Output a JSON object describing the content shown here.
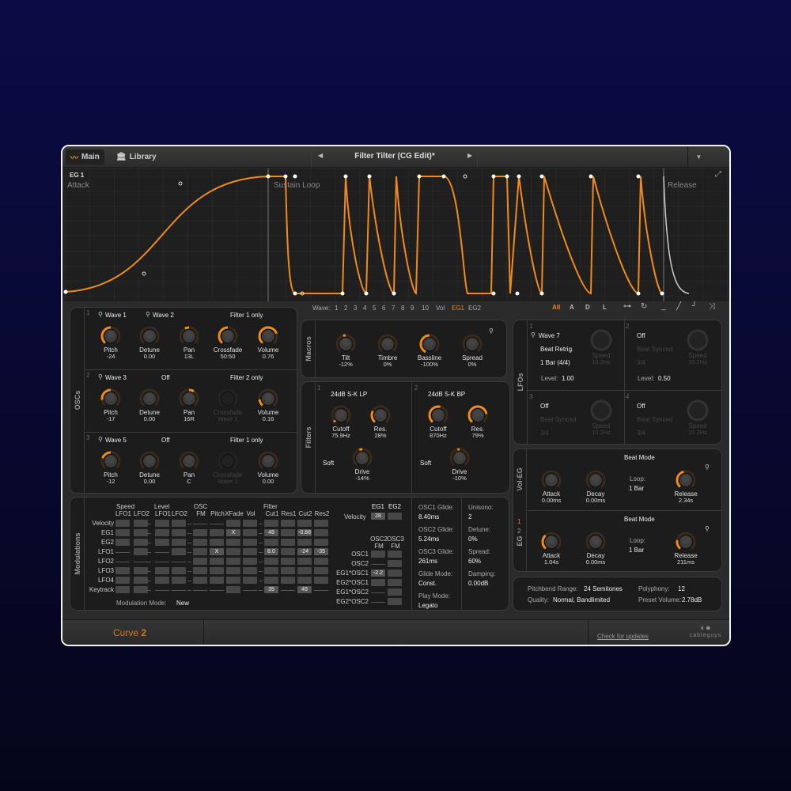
{
  "colors": {
    "accent": "#f08a1c",
    "bg": "#2b2b2b"
  },
  "topbar": {
    "main_tab": "Main",
    "library_tab": "Library",
    "preset_title": "Filter Tilter (CG Edit)*",
    "prev_icon": "triangle-left",
    "next_icon": "triangle-right",
    "menu_icon": "triangle-down"
  },
  "eg": {
    "title": "EG 1",
    "attack": "Attack",
    "sustain": "Sustain Loop",
    "release": "Release"
  },
  "wave_row": {
    "label": "Wave:",
    "items": [
      "1",
      "2",
      "3",
      "4",
      "5",
      "6",
      "7",
      "8",
      "9",
      "10",
      "Vol",
      "EG1",
      "EG2"
    ],
    "active": "EG1",
    "filters": [
      "All",
      "A",
      "D",
      "L"
    ],
    "active_filter": "All"
  },
  "oscs": {
    "label": "OSCs",
    "rows": [
      {
        "num": "1",
        "wave_a": "Wave 1",
        "wave_b": "Wave 2",
        "filter": "Filter 1 only",
        "knobs": [
          {
            "label": "Pitch",
            "value": "-24",
            "amount": -0.5
          },
          {
            "label": "Detune",
            "value": "0.00",
            "amount": 0
          },
          {
            "label": "Pan",
            "value": "13L",
            "amount": -0.1
          },
          {
            "label": "Crossfade",
            "value": "50:50",
            "amount": 0.5,
            "uni": true
          },
          {
            "label": "Volume",
            "value": "0.76",
            "amount": 0.76,
            "uni": true
          }
        ]
      },
      {
        "num": "2",
        "wave_a": "Wave 3",
        "wave_b": "Off",
        "filter": "Filter 2 only",
        "knobs": [
          {
            "label": "Pitch",
            "value": "-17",
            "amount": -0.35
          },
          {
            "label": "Detune",
            "value": "0.00",
            "amount": 0
          },
          {
            "label": "Pan",
            "value": "16R",
            "amount": 0.12
          },
          {
            "label": "Crossfade",
            "value": "Wave 1",
            "amount": 0,
            "off": true
          },
          {
            "label": "Volume",
            "value": "0.16",
            "amount": 0.16,
            "uni": true
          }
        ]
      },
      {
        "num": "3",
        "wave_a": "Wave 5",
        "wave_b": "Off",
        "filter": "Filter 1 only",
        "knobs": [
          {
            "label": "Pitch",
            "value": "-12",
            "amount": -0.25
          },
          {
            "label": "Detune",
            "value": "0.00",
            "amount": 0
          },
          {
            "label": "Pan",
            "value": "C",
            "amount": 0
          },
          {
            "label": "Crossfade",
            "value": "Wave 1",
            "amount": 0,
            "off": true
          },
          {
            "label": "Volume",
            "value": "0.00",
            "amount": 0,
            "uni": true
          }
        ]
      }
    ]
  },
  "macros": {
    "label": "Macros",
    "knobs": [
      {
        "label": "Tilt",
        "value": "-12%",
        "amount": -0.06
      },
      {
        "label": "Timbre",
        "value": "0%",
        "amount": 0
      },
      {
        "label": "Bassline",
        "value": "-100%",
        "amount": -0.55
      },
      {
        "label": "Spread",
        "value": "0%",
        "amount": 0
      }
    ]
  },
  "filters": {
    "label": "Filters",
    "units": [
      {
        "num": "1",
        "type": "24dB S-K LP",
        "drive_mode": "Soft",
        "knobs": [
          {
            "label": "Cutoff",
            "value": "75.9Hz",
            "amount": 0.05,
            "uni": true
          },
          {
            "label": "Res.",
            "value": "28%",
            "amount": 0.28,
            "uni": true
          },
          {
            "label": "Drive",
            "value": "-14%",
            "amount": -0.07
          }
        ]
      },
      {
        "num": "2",
        "type": "24dB S-K BP",
        "drive_mode": "Soft",
        "knobs": [
          {
            "label": "Cutoff",
            "value": "870Hz",
            "amount": 0.55,
            "uni": true
          },
          {
            "label": "Res.",
            "value": "79%",
            "amount": 0.79,
            "uni": true
          },
          {
            "label": "Drive",
            "value": "-10%",
            "amount": -0.05
          }
        ]
      }
    ]
  },
  "lfos": {
    "label": "LFOs",
    "units": [
      {
        "num": "1",
        "wave": "Wave 7",
        "mode": "Beat Retrig.",
        "rate": "1 Bar (4/4)",
        "level_label": "Level:",
        "level": "1.00",
        "speed_label": "Speed",
        "speed": "10.2Hz",
        "active": true
      },
      {
        "num": "2",
        "wave": "Off",
        "mode": "Beat Synced",
        "rate": "3/4",
        "level_label": "Level:",
        "level": "0.50",
        "speed_label": "Speed",
        "speed": "10.2Hz",
        "active": false
      },
      {
        "num": "3",
        "wave": "Off",
        "mode": "Beat Synced",
        "rate": "3/4",
        "speed_label": "Speed",
        "speed": "10.2Hz",
        "active": false
      },
      {
        "num": "4",
        "wave": "Off",
        "mode": "Beat Synced",
        "rate": "3/4",
        "speed_label": "Speed",
        "speed": "10.2Hz",
        "active": false
      }
    ]
  },
  "vol_eg": {
    "label": "Vol-EG",
    "mode": "Beat Mode",
    "loop_label": "Loop:",
    "loop": "1 Bar",
    "knobs": [
      {
        "label": "Attack",
        "value": "0.00ms",
        "amount": 0,
        "uni": true
      },
      {
        "label": "Decay",
        "value": "0.00ms",
        "amount": 0,
        "uni": true
      },
      {
        "label": "Release",
        "value": "2.34s",
        "amount": 0.45,
        "uni": true
      }
    ]
  },
  "eg_panel": {
    "label": "EG",
    "sel1": "1",
    "sel2": "2",
    "mode": "Beat Mode",
    "loop_label": "Loop:",
    "loop": "1 Bar",
    "knobs": [
      {
        "label": "Attack",
        "value": "1.04s",
        "amount": 0.35,
        "uni": true
      },
      {
        "label": "Decay",
        "value": "0.00ms",
        "amount": 0,
        "uni": true
      },
      {
        "label": "Release",
        "value": "211ms",
        "amount": 0.22,
        "uni": true
      }
    ]
  },
  "global": {
    "pitchbend_label": "Pitchbend Range:",
    "pitchbend": "24 Semitones",
    "polyphony_label": "Polyphony:",
    "polyphony": "12",
    "quality_label": "Quality:",
    "quality": "Normal, Bandlimited",
    "preset_volume_label": "Preset Volume:",
    "preset_volume": "2.78dB"
  },
  "modulations": {
    "label": "Modulations",
    "groups": [
      "Speed",
      "Level",
      "OSC",
      "Filter"
    ],
    "columns": [
      "LFO1",
      "LFO2",
      "LFO1",
      "LFO2",
      "FM",
      "Pitch",
      "XFade",
      "Vol",
      "Cut1",
      "Res1",
      "Cut2",
      "Res2"
    ],
    "rows": [
      {
        "name": "Velocity",
        "cells": [
          "",
          "",
          null,
          "",
          "",
          null,
          null,
          null,
          "",
          "",
          null,
          "",
          "",
          "",
          ""
        ]
      },
      {
        "name": "EG1",
        "cells": [
          "",
          "",
          null,
          "",
          "",
          null,
          "",
          "",
          "X",
          "",
          null,
          "48",
          "",
          "-0.88",
          ""
        ]
      },
      {
        "name": "EG2",
        "cells": [
          "",
          "",
          null,
          "",
          "",
          null,
          "",
          "",
          "",
          "",
          null,
          "",
          "",
          "",
          ""
        ]
      },
      {
        "name": "LFO1",
        "cells": [
          null,
          "",
          null,
          null,
          "",
          null,
          "",
          "X",
          "",
          "",
          null,
          "8.0",
          "",
          "-24",
          "-35"
        ]
      },
      {
        "name": "LFO2",
        "cells": [
          null,
          null,
          null,
          null,
          null,
          null,
          "",
          "",
          "",
          "",
          null,
          "",
          "",
          "",
          ""
        ]
      },
      {
        "name": "LFO3",
        "cells": [
          "",
          "",
          null,
          "",
          "",
          null,
          "",
          "",
          "",
          "",
          null,
          "",
          "",
          "",
          ""
        ]
      },
      {
        "name": "LFO4",
        "cells": [
          "",
          "",
          null,
          "",
          "",
          null,
          "",
          "",
          "",
          "",
          null,
          "",
          "",
          "",
          ""
        ]
      },
      {
        "name": "Keytrack",
        "cells": [
          "",
          "",
          null,
          null,
          null,
          null,
          null,
          null,
          "",
          null,
          null,
          "35",
          null,
          "49",
          null
        ]
      }
    ],
    "mode_label": "Modulation Mode:",
    "mode": "New",
    "velocity": {
      "cols": [
        "EG1",
        "EG2"
      ],
      "label": "Velocity",
      "values": [
        "28",
        ""
      ]
    },
    "fm": {
      "cols_top": [
        "OSC2",
        "OSC3"
      ],
      "cols_bottom": [
        "FM",
        "FM"
      ],
      "rows": [
        {
          "name": "OSC1",
          "cells": [
            "",
            ""
          ]
        },
        {
          "name": "OSC2",
          "cells": [
            null,
            ""
          ]
        },
        {
          "name": "EG1*OSC1",
          "cells": [
            "-2.2",
            ""
          ]
        },
        {
          "name": "EG2*OSC1",
          "cells": [
            "",
            ""
          ]
        },
        {
          "name": "EG1*OSC2",
          "cells": [
            null,
            ""
          ]
        },
        {
          "name": "EG2*OSC2",
          "cells": [
            null,
            ""
          ]
        }
      ]
    },
    "glide": [
      {
        "label": "OSC1 Glide:",
        "value": "8.40ms"
      },
      {
        "label": "OSC2 Glide:",
        "value": "5.24ms"
      },
      {
        "label": "OSC3 Glide:",
        "value": "261ms"
      },
      {
        "label": "Glide Mode:",
        "value": "Const."
      },
      {
        "label": "Play Mode:",
        "value": "Legato"
      }
    ],
    "unison": [
      {
        "label": "Unisono:",
        "value": "2"
      },
      {
        "label": "Detune:",
        "value": "0%"
      },
      {
        "label": "Spread:",
        "value": "60%"
      },
      {
        "label": "Damping:",
        "value": "0.00dB"
      }
    ]
  },
  "footer": {
    "product": "Curve",
    "version": "2",
    "updates_link": "Check for updates",
    "brand": "cableguys"
  }
}
